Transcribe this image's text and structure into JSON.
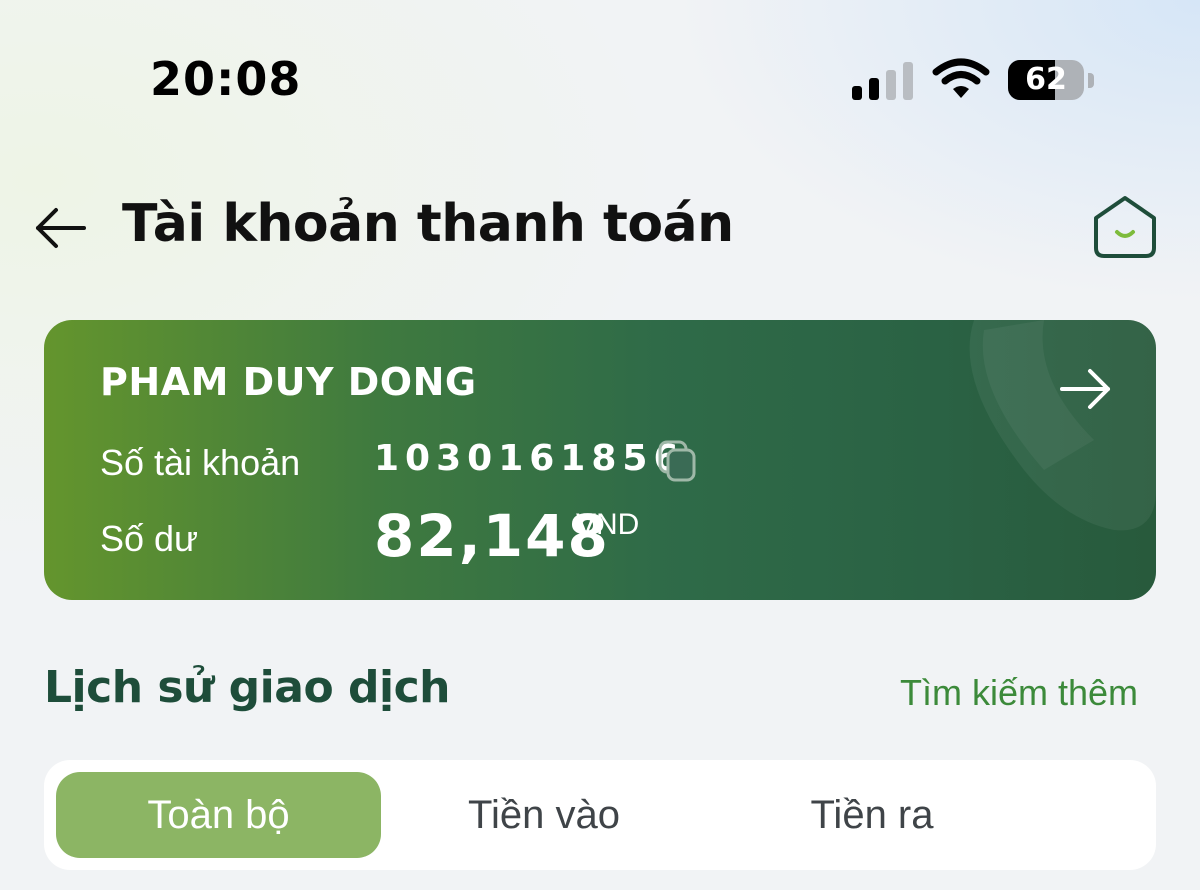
{
  "status_bar": {
    "time": "20:08",
    "battery_percent": "62",
    "battery_level": 0.62,
    "signal_bars_active": 2,
    "signal_bars_total": 4
  },
  "header": {
    "title": "Tài khoản thanh toán",
    "back_icon": "arrow-left-icon",
    "home_icon": "home-icon"
  },
  "account_card": {
    "holder_name": "PHAM DUY DONG",
    "account_number_label": "Số tài khoản",
    "account_number": "1030161856",
    "balance_label": "Số dư",
    "balance": "82,148",
    "currency": "VND",
    "detail_icon": "arrow-right-icon",
    "copy_icon": "copy-icon"
  },
  "history": {
    "title": "Lịch sử giao dịch",
    "search_more": "Tìm kiếm thêm",
    "tabs": [
      {
        "label": "Toàn bộ",
        "active": true
      },
      {
        "label": "Tiền vào",
        "active": false
      },
      {
        "label": "Tiền ra",
        "active": false
      }
    ]
  },
  "colors": {
    "brand_green": "#2f6b48",
    "accent_green": "#3c8a3a",
    "active_tab": "#8cb564",
    "title_dark_green": "#1e4d3a"
  }
}
